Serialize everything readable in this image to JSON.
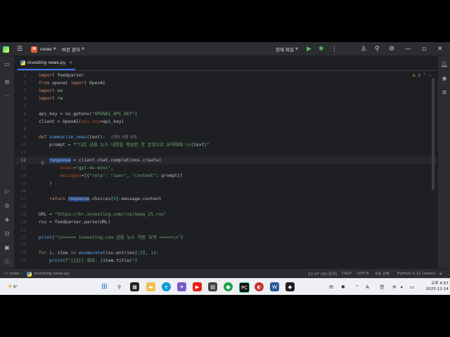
{
  "titlebar": {
    "project_badge": "N",
    "project_name": "news",
    "vcs_label": "버전 관리",
    "run_config": "현재 파일"
  },
  "tab": {
    "filename": "investing news.py"
  },
  "editor": {
    "warning_count": "2",
    "usage_hint": "1개의 사용 위치",
    "lines": [
      {
        "n": "1",
        "html": "<span class=\"kw\">import</span> feedparser"
      },
      {
        "n": "2",
        "html": "<span class=\"kw\">from</span> openai <span class=\"kw\">import</span> OpenAI"
      },
      {
        "n": "3",
        "html": "<span class=\"kw\">import</span> os"
      },
      {
        "n": "4",
        "html": "<span class=\"kw\">import</span> re"
      },
      {
        "n": "5",
        "html": ""
      },
      {
        "n": "6",
        "html": "api_key = os.getenv(<span class=\"str\">\"OPENAI_API_KEY\"</span>)"
      },
      {
        "n": "7",
        "html": "client = OpenAI(<span class=\"param\">api_key</span>=api_key)"
      },
      {
        "n": "8",
        "html": ""
      },
      {
        "n": "9",
        "html": "<span class=\"kw\">def</span> <span class=\"fn\">summarize_news</span>(text):  <span class=\"hint\">1개의 사용 위치</span>"
      },
      {
        "n": "10",
        "html": "    prompt = <span class=\"str\">f\"다음 금융 뉴스 내용을 핵심만 한 문장으로 요약해줘:\\n{</span>text<span class=\"str\">}\"</span>"
      },
      {
        "n": "11",
        "html": ""
      },
      {
        "n": "12",
        "html": "    <span class=\"hl\">response</span> = client.chat.completions.create(",
        "current": true
      },
      {
        "n": "13",
        "html": "        <span class=\"param\">model</span>=<span class=\"str\">\"gpt-4o-mini\"</span>,"
      },
      {
        "n": "14",
        "html": "        <span class=\"param\">messages</span>=[{<span class=\"str\">\"role\"</span>: <span class=\"str\">\"user\"</span>, <span class=\"str\">\"content\"</span>: prompt}]"
      },
      {
        "n": "15",
        "html": "    )"
      },
      {
        "n": "16",
        "html": ""
      },
      {
        "n": "17",
        "html": "    <span class=\"kw\">return</span> <span class=\"hl\">response</span>.choices[<span class=\"num\">0</span>].message.content"
      },
      {
        "n": "18",
        "html": ""
      },
      {
        "n": "19",
        "html": "URL = <span class=\"str\">\"https://kr.investing.com/rss/news_25.rss\"</span>"
      },
      {
        "n": "20",
        "html": "rss = feedparser.parse(URL)"
      },
      {
        "n": "21",
        "html": ""
      },
      {
        "n": "22",
        "html": "<span class=\"fn\">print</span>(<span class=\"str\">\"\\n===== investing.com 금융 뉴스 자동 요약 =====\\n\"</span>)"
      },
      {
        "n": "23",
        "html": ""
      },
      {
        "n": "24",
        "html": "<span class=\"kw\">for</span> i, item <span class=\"kw\">in</span> <span class=\"fn\">enumerate</span>(rss.entries[:<span class=\"num\">3</span>], <span class=\"num\">1</span>):"
      },
      {
        "n": "25",
        "html": "    <span class=\"fn\">print</span>(<span class=\"str\">f\"[{</span>i<span class=\"str\">}] 제목: {</span>item.title<span class=\"str\">}\"</span>)"
      }
    ]
  },
  "statusbar": {
    "project": "news",
    "file": "investing news.py",
    "position": "12:47 (42 문자)",
    "line_ending": "CRLF",
    "encoding": "UTF-8",
    "indent": "4개 공백",
    "interpreter": "Python 3.12 (news)"
  },
  "taskbar": {
    "weather": "6°",
    "ime_lang": "A",
    "ime_mode": "한",
    "time": "오후 4:57",
    "date": "2025-12-14"
  }
}
